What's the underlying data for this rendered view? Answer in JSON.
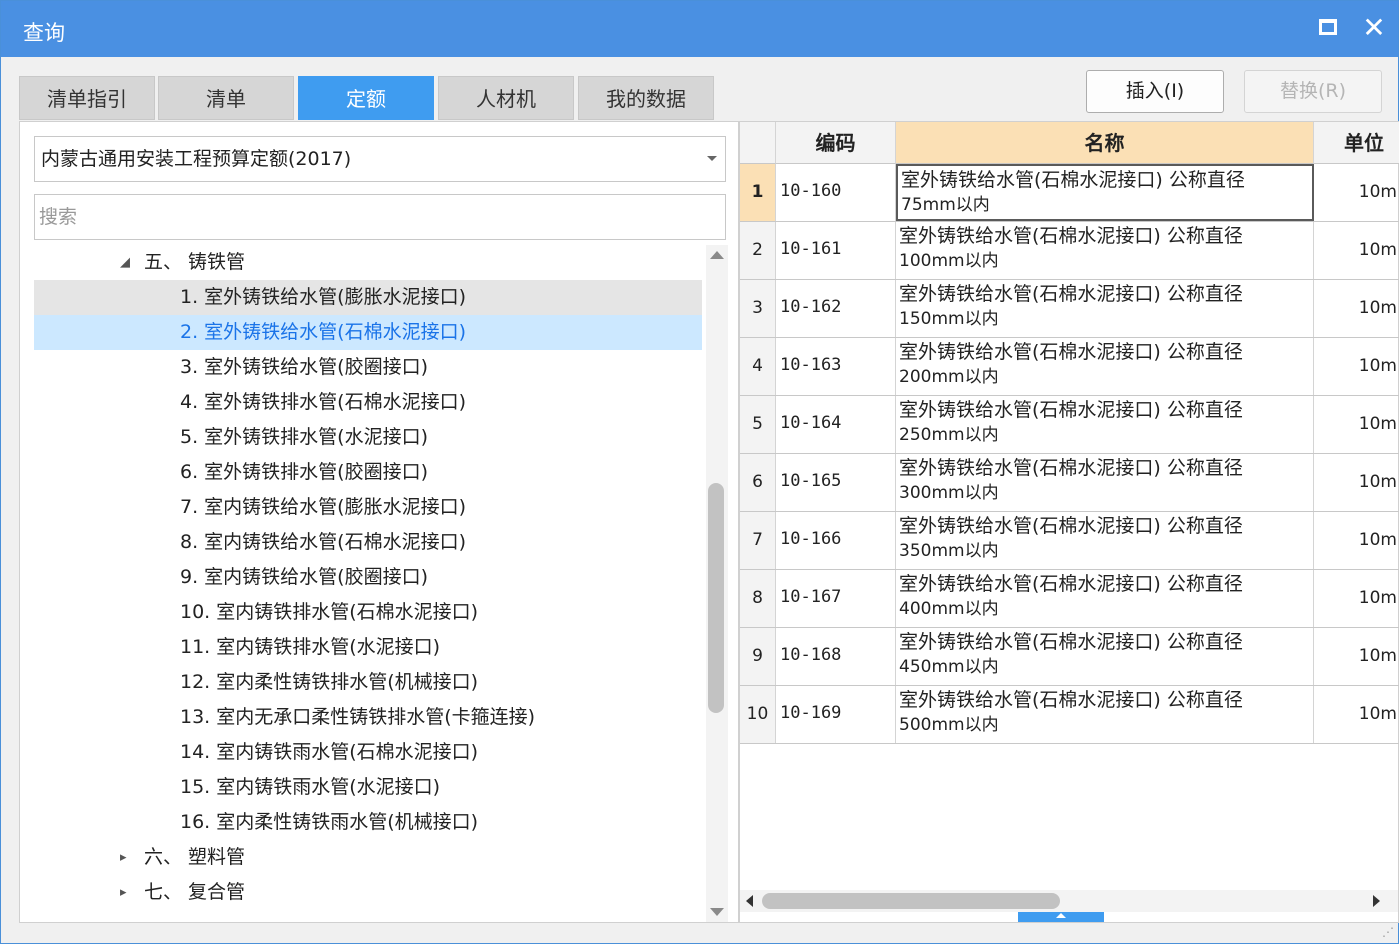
{
  "window": {
    "title": "查询"
  },
  "tabs": [
    {
      "label": "清单指引"
    },
    {
      "label": "清单"
    },
    {
      "label": "定额",
      "active": true
    },
    {
      "label": "人材机"
    },
    {
      "label": "我的数据"
    }
  ],
  "actions": {
    "insert_label": "插入(I)",
    "replace_label": "替换(R)"
  },
  "left": {
    "library_select": "内蒙古通用安装工程预算定额(2017)",
    "search_placeholder": "搜索",
    "tree": [
      {
        "label": "五、 铸铁管",
        "level": 1,
        "expanded": true
      },
      {
        "label": "1. 室外铸铁给水管(膨胀水泥接口)",
        "level": 2,
        "state": "hover"
      },
      {
        "label": "2. 室外铸铁给水管(石棉水泥接口)",
        "level": 2,
        "state": "selected"
      },
      {
        "label": "3. 室外铸铁给水管(胶圈接口)",
        "level": 2
      },
      {
        "label": "4. 室外铸铁排水管(石棉水泥接口)",
        "level": 2
      },
      {
        "label": "5. 室外铸铁排水管(水泥接口)",
        "level": 2
      },
      {
        "label": "6. 室外铸铁排水管(胶圈接口)",
        "level": 2
      },
      {
        "label": "7. 室内铸铁给水管(膨胀水泥接口)",
        "level": 2
      },
      {
        "label": "8. 室内铸铁给水管(石棉水泥接口)",
        "level": 2
      },
      {
        "label": "9. 室内铸铁给水管(胶圈接口)",
        "level": 2
      },
      {
        "label": "10. 室内铸铁排水管(石棉水泥接口)",
        "level": 2
      },
      {
        "label": "11. 室内铸铁排水管(水泥接口)",
        "level": 2
      },
      {
        "label": "12. 室内柔性铸铁排水管(机械接口)",
        "level": 2
      },
      {
        "label": "13. 室内无承口柔性铸铁排水管(卡箍连接)",
        "level": 2
      },
      {
        "label": "14. 室内铸铁雨水管(石棉水泥接口)",
        "level": 2
      },
      {
        "label": "15. 室内铸铁雨水管(水泥接口)",
        "level": 2
      },
      {
        "label": "16. 室内柔性铸铁雨水管(机械接口)",
        "level": 2
      },
      {
        "label": "六、 塑料管",
        "level": 1,
        "expanded": false
      },
      {
        "label": "七、 复合管",
        "level": 1,
        "expanded": false
      }
    ]
  },
  "grid": {
    "columns": {
      "code": "编码",
      "name": "名称",
      "unit": "单位"
    },
    "rows": [
      {
        "num": "1",
        "code": "10-160",
        "name1": "室外铸铁给水管(石棉水泥接口) 公称直径",
        "name2": "75mm以内",
        "unit": "10m"
      },
      {
        "num": "2",
        "code": "10-161",
        "name1": "室外铸铁给水管(石棉水泥接口) 公称直径",
        "name2": "100mm以内",
        "unit": "10m"
      },
      {
        "num": "3",
        "code": "10-162",
        "name1": "室外铸铁给水管(石棉水泥接口) 公称直径",
        "name2": "150mm以内",
        "unit": "10m"
      },
      {
        "num": "4",
        "code": "10-163",
        "name1": "室外铸铁给水管(石棉水泥接口) 公称直径",
        "name2": "200mm以内",
        "unit": "10m"
      },
      {
        "num": "5",
        "code": "10-164",
        "name1": "室外铸铁给水管(石棉水泥接口) 公称直径",
        "name2": "250mm以内",
        "unit": "10m"
      },
      {
        "num": "6",
        "code": "10-165",
        "name1": "室外铸铁给水管(石棉水泥接口) 公称直径",
        "name2": "300mm以内",
        "unit": "10m"
      },
      {
        "num": "7",
        "code": "10-166",
        "name1": "室外铸铁给水管(石棉水泥接口) 公称直径",
        "name2": "350mm以内",
        "unit": "10m"
      },
      {
        "num": "8",
        "code": "10-167",
        "name1": "室外铸铁给水管(石棉水泥接口) 公称直径",
        "name2": "400mm以内",
        "unit": "10m"
      },
      {
        "num": "9",
        "code": "10-168",
        "name1": "室外铸铁给水管(石棉水泥接口) 公称直径",
        "name2": "450mm以内",
        "unit": "10m"
      },
      {
        "num": "10",
        "code": "10-169",
        "name1": "室外铸铁给水管(石棉水泥接口) 公称直径",
        "name2": "500mm以内",
        "unit": "10m"
      }
    ]
  },
  "colors": {
    "titlebar": "#4a90e2",
    "active_tab": "#3f9cf0",
    "selected_row": "#cce8ff",
    "header_highlight": "#fbe0b5"
  },
  "icons": {
    "maximize": "maximize-icon",
    "close": "close-icon"
  }
}
